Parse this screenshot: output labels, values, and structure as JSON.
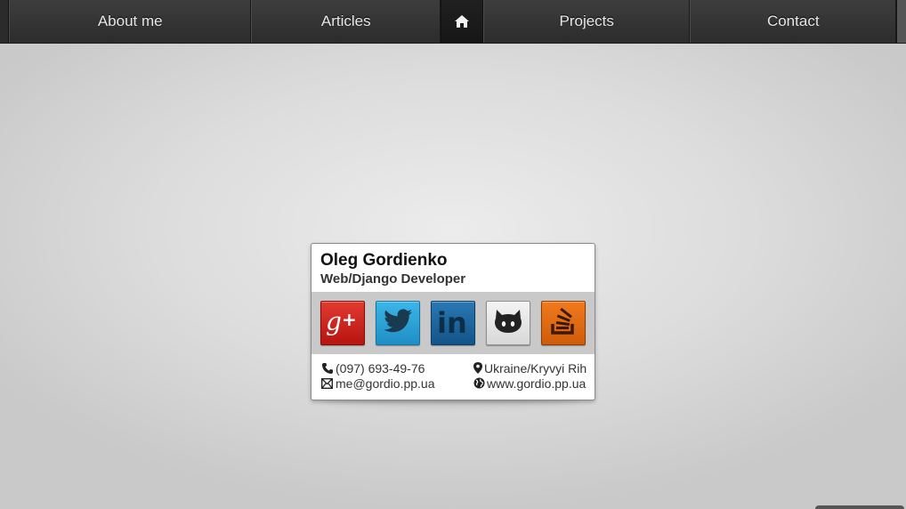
{
  "nav": {
    "items": [
      {
        "label": "About me"
      },
      {
        "label": "Articles"
      },
      {
        "label": "Projects"
      },
      {
        "label": "Contact"
      }
    ],
    "home_icon": "home-icon"
  },
  "card": {
    "name": "Oleg Gordienko",
    "role": "Web/Django Developer",
    "social": [
      {
        "name": "Google+",
        "icon": "google-plus-icon",
        "color": "#c91d15"
      },
      {
        "name": "Twitter",
        "icon": "twitter-icon",
        "color": "#2aa3db"
      },
      {
        "name": "LinkedIn",
        "icon": "linkedin-icon",
        "color": "#1b6499"
      },
      {
        "name": "GitHub",
        "icon": "github-icon",
        "color": "#e6e6e6"
      },
      {
        "name": "Stack Overflow",
        "icon": "stackoverflow-icon",
        "color": "#e06a12"
      }
    ],
    "contacts": {
      "phone": "(097)  693-49-76",
      "location": "Ukraine/Kryvyi  Rih",
      "email": "me@gordio.pp.ua",
      "website": "www.gordio.pp.ua"
    }
  }
}
